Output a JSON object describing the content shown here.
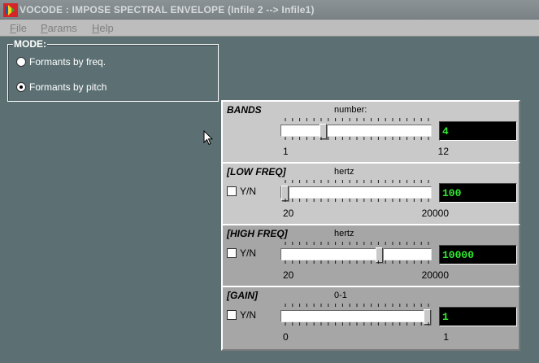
{
  "window": {
    "title": "VOCODE : IMPOSE SPECTRAL ENVELOPE (Infile 2  --> Infile1)",
    "icon": "vocode-app-icon"
  },
  "menu": [
    {
      "underline": "F",
      "rest": "ile"
    },
    {
      "underline": "P",
      "rest": "arams"
    },
    {
      "underline": "H",
      "rest": "elp"
    }
  ],
  "mode": {
    "title": "MODE:",
    "options": [
      {
        "label": "Formants by freq.",
        "selected": false
      },
      {
        "label": "Formants by pitch",
        "selected": true
      }
    ]
  },
  "params": [
    {
      "name": "BANDS",
      "unit": "number:",
      "has_toggle": false,
      "min": "1",
      "max": "12",
      "value": "4",
      "position": 0.27,
      "dim": false
    },
    {
      "name": "[LOW FREQ]",
      "unit": "hertz",
      "has_toggle": true,
      "toggle_label": "Y/N",
      "toggle_checked": false,
      "min": "20",
      "max": "20000",
      "value": "100",
      "position": 0.0,
      "dim": false
    },
    {
      "name": "[HIGH FREQ]",
      "unit": "hertz",
      "has_toggle": true,
      "toggle_label": "Y/N",
      "toggle_checked": false,
      "min": "20",
      "max": "20000",
      "value": "10000",
      "position": 0.66,
      "dim": true
    },
    {
      "name": "[GAIN]",
      "unit": "0-1",
      "has_toggle": true,
      "toggle_label": "Y/N",
      "toggle_checked": false,
      "min": "0",
      "max": "1",
      "value": "1",
      "position": 1.0,
      "dim": true
    }
  ],
  "colors": {
    "desktop": "#5c7073",
    "value_text": "#33e833",
    "value_bg": "#000000"
  }
}
